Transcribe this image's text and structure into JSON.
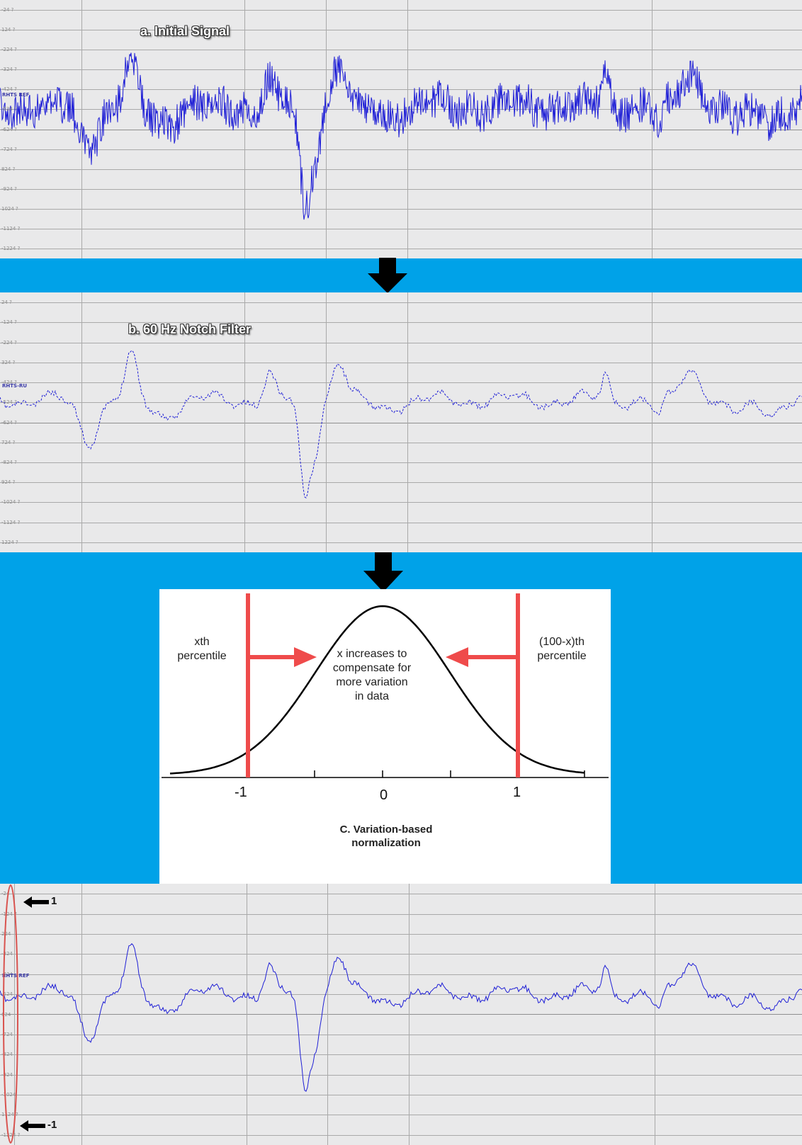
{
  "colors": {
    "background": "#00a2e8",
    "panel": "#e9e9ea",
    "grid": "#a9a9a9",
    "signal": "#1f1fd6",
    "red": "#ef4b4b",
    "bell_curve": "#000000"
  },
  "panel_a": {
    "title": "a. Initial Signal",
    "channel": "RHTS REF",
    "ticks": [
      "-24 ?",
      "124 ?",
      "-224 ?",
      "-324 ?",
      "-424 ?",
      "-524 ?",
      "-624 ?",
      "-724 ?",
      "824 ?",
      "-924 ?",
      "1024 ?",
      "-1124 ?",
      "-1224 ?"
    ]
  },
  "panel_b": {
    "title": "b. 60 Hz Notch Filter",
    "channel": "RHTS-RU",
    "ticks": [
      "24 ?",
      "-124 ?",
      "-224 ?",
      "324 ?",
      "-424 ?",
      "-524 ?",
      "-624 ?",
      "724 ?",
      "-824 ?",
      "924 ?",
      "-1024 ?",
      "-1124 ?",
      "1224 ?"
    ]
  },
  "panel_c": {
    "title_line1": "C. Variation-based",
    "title_line2": "normalization",
    "left_label_line1": "xth",
    "left_label_line2": "percentile",
    "right_label_line1": "(100-x)th",
    "right_label_line2": "percentile",
    "center_text": [
      "x increases to",
      "compensate for",
      "more variation",
      "in data"
    ],
    "axis_labels": [
      "-1",
      "0",
      "1"
    ]
  },
  "panel_d": {
    "channel": "RHTS REF",
    "ticks": [
      "-24",
      "-124 ?",
      "224",
      "-324",
      "-424",
      "-524",
      "624",
      "-724",
      "-824",
      "-924",
      "-1024",
      "1124 ?",
      "-1224 ?"
    ],
    "top_marker": "1",
    "bottom_marker": "-1"
  },
  "icons": [
    "down-arrow-icon",
    "left-arrow-icon",
    "right-arrow-icon"
  ]
}
